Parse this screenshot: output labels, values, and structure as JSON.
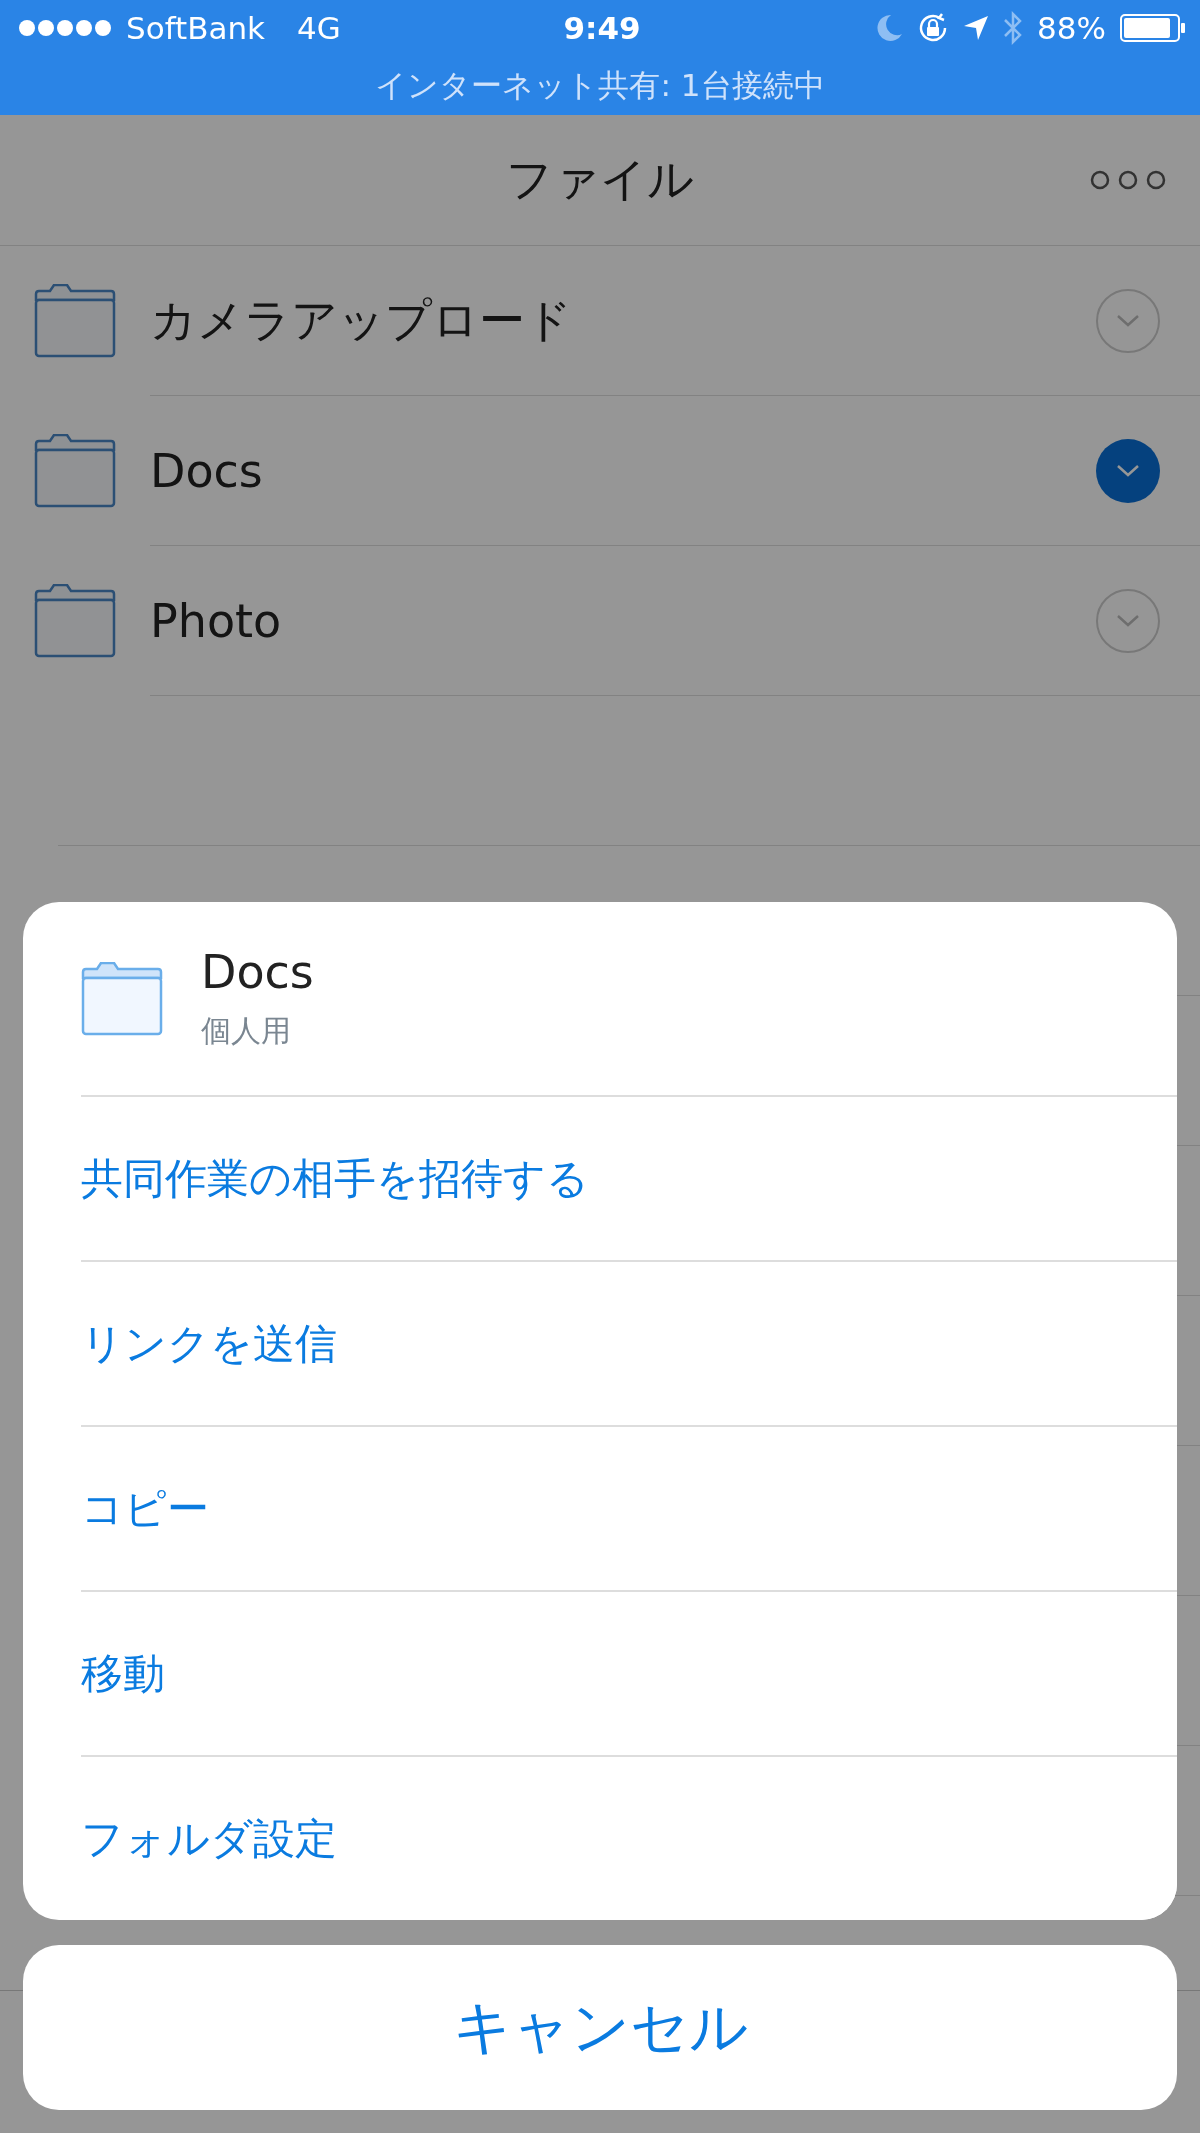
{
  "status_bar": {
    "carrier": "SoftBank",
    "network": "4G",
    "time": "9:49",
    "battery": "88%",
    "hotspot": "インターネット共有: 1台接続中"
  },
  "nav": {
    "title": "ファイル"
  },
  "folders": [
    {
      "name": "カメラアップロード",
      "selected": false
    },
    {
      "name": "Docs",
      "selected": true
    },
    {
      "name": "Photo",
      "selected": false
    }
  ],
  "action_sheet": {
    "title": "Docs",
    "subtitle": "個人用",
    "items": [
      "共同作業の相手を招待する",
      "リンクを送信",
      "コピー",
      "移動",
      "フォルダ設定"
    ],
    "cancel": "キャンセル"
  }
}
